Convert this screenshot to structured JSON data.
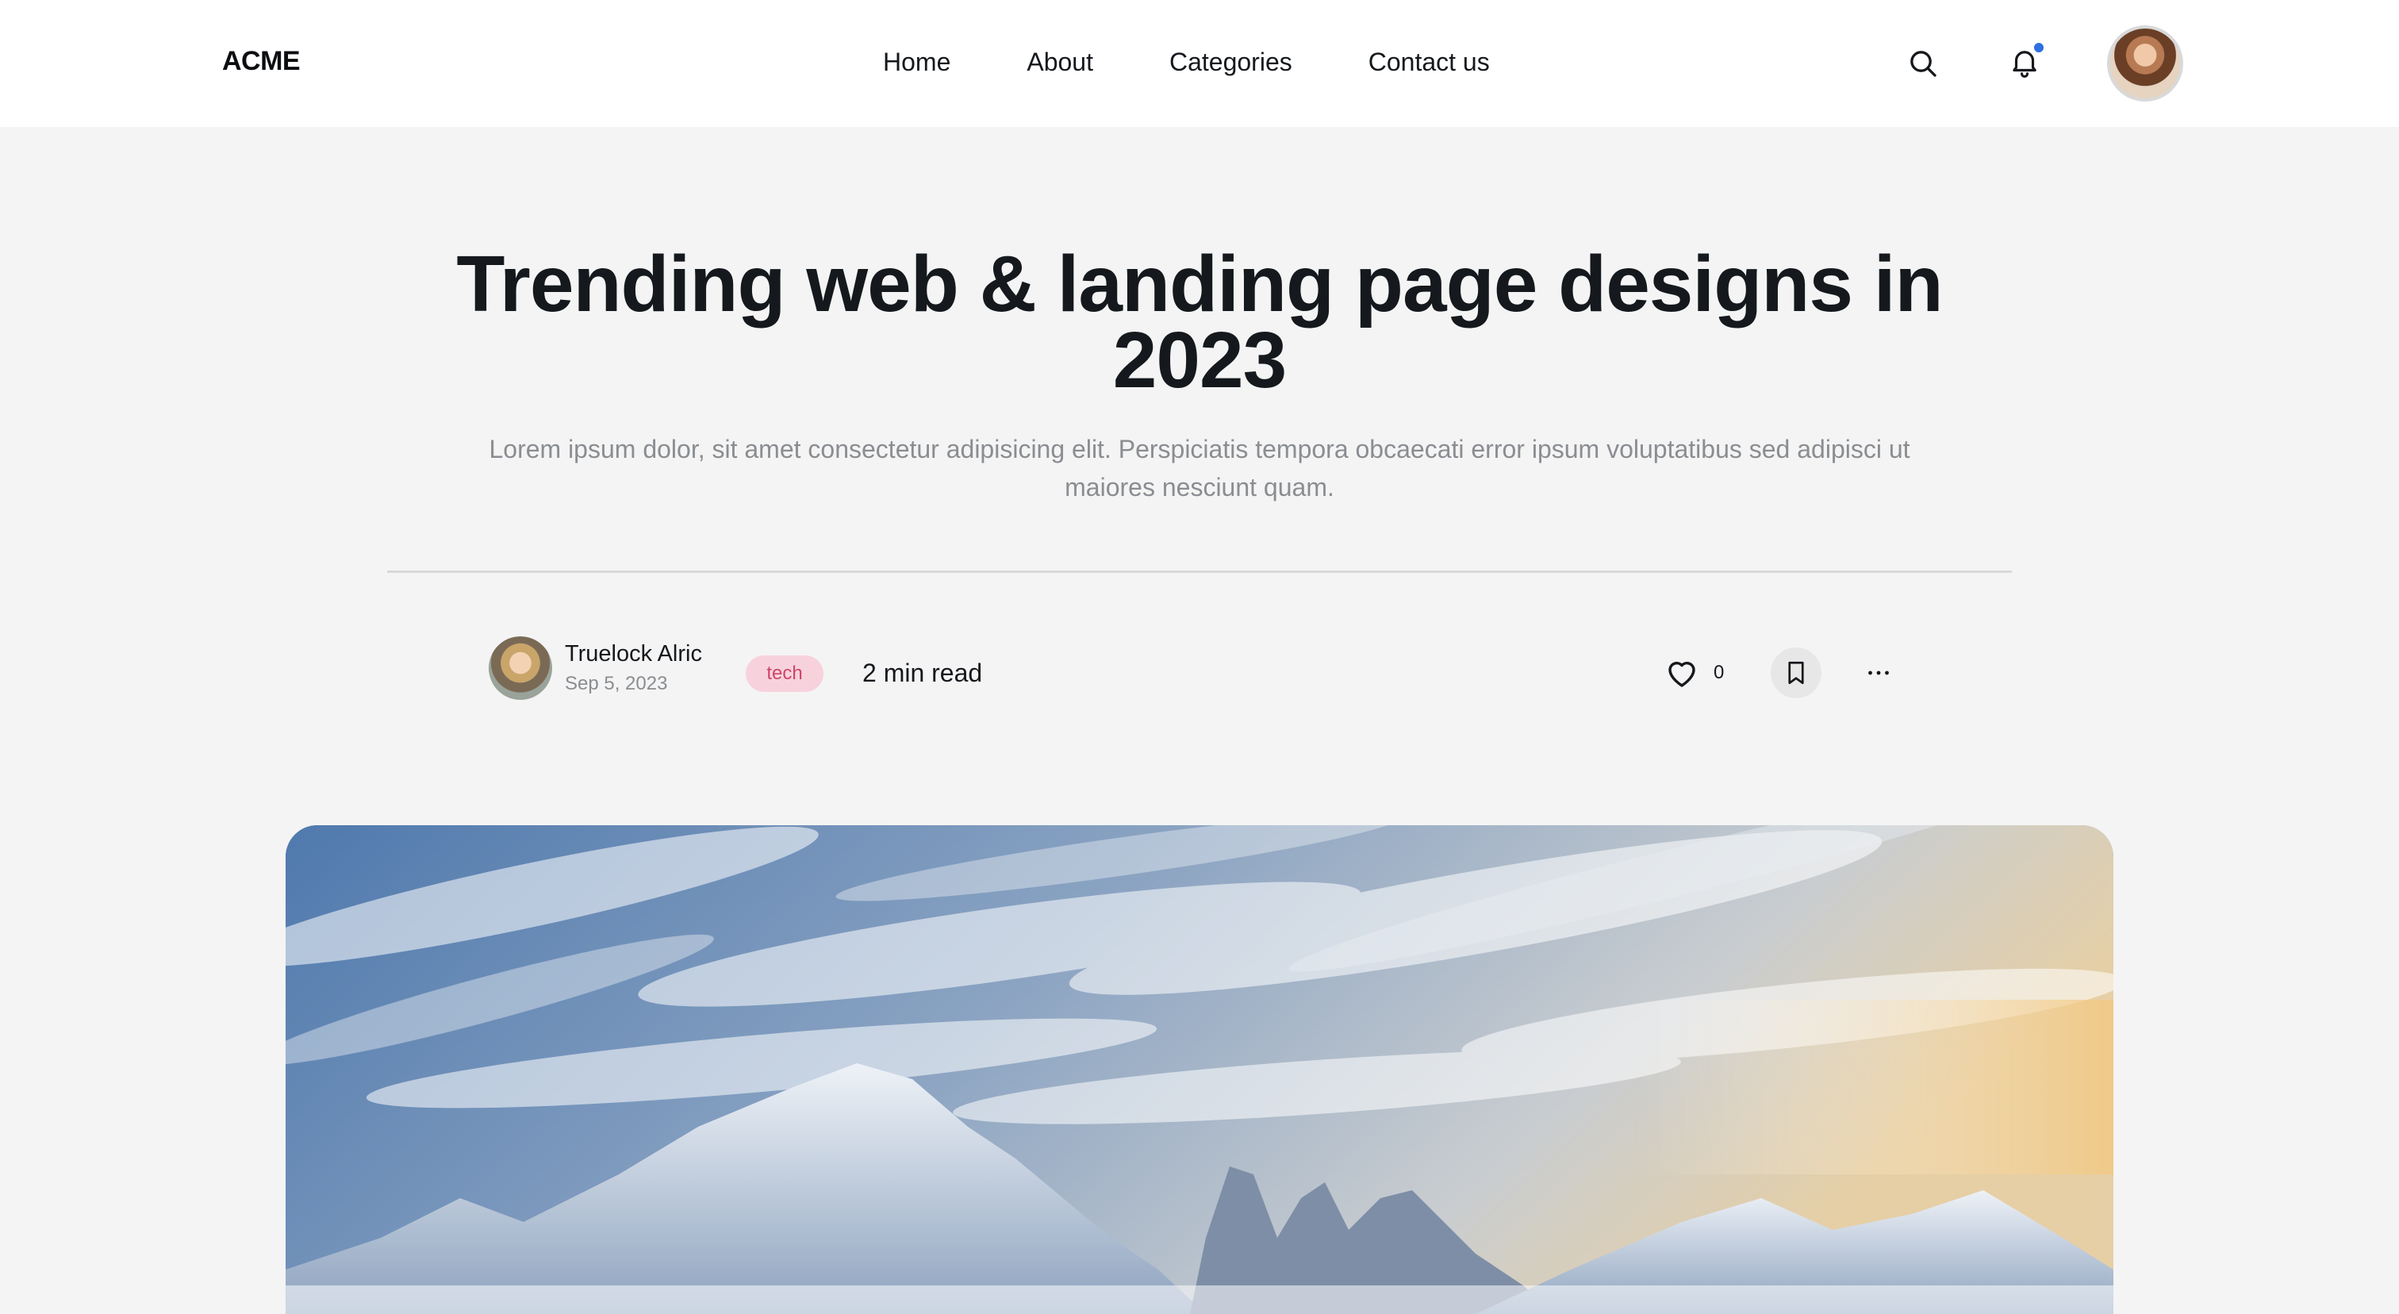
{
  "header": {
    "brand": "ACME",
    "nav": [
      {
        "label": "Home"
      },
      {
        "label": "About"
      },
      {
        "label": "Categories"
      },
      {
        "label": "Contact us"
      }
    ],
    "icons": {
      "search": "search-icon",
      "notifications": "bell-icon"
    },
    "notification_dot_color": "#2f6fe0"
  },
  "article": {
    "title": "Trending web & landing page designs in 2023",
    "subtitle": "Lorem ipsum dolor, sit amet consectetur adipisicing elit. Perspiciatis tempora obcaecati error ipsum voluptatibus sed adipisci ut maiores nesciunt quam.",
    "author": {
      "name": "Truelock Alric",
      "date": "Sep 5, 2023"
    },
    "tag": "tech",
    "read_time": "2 min read",
    "likes": "0",
    "colors": {
      "tag_bg": "#f7d2dc",
      "tag_text": "#d0446b"
    },
    "actions": {
      "like": "heart-icon",
      "bookmark": "bookmark-icon",
      "more": "more-icon"
    }
  }
}
